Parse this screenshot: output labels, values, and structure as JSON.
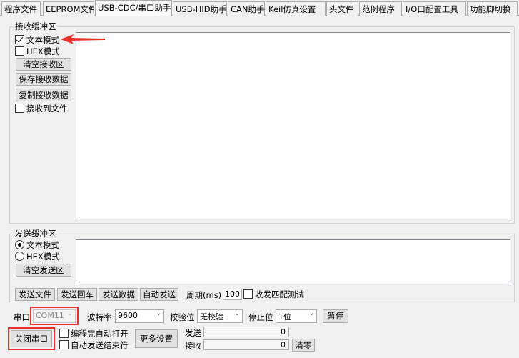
{
  "tabs": [
    {
      "label": "程序文件"
    },
    {
      "label": "EEPROM文件"
    },
    {
      "label": "USB-CDC/串口助手",
      "active": true
    },
    {
      "label": "USB-HID助手"
    },
    {
      "label": "CAN助手"
    },
    {
      "label": "Keil仿真设置"
    },
    {
      "label": "头文件"
    },
    {
      "label": "范例程序"
    },
    {
      "label": "I/O口配置工具"
    },
    {
      "label": "功能脚切换"
    }
  ],
  "receive": {
    "group_label": "接收缓冲区",
    "text_mode": "文本模式",
    "text_mode_checked": true,
    "hex_mode": "HEX模式",
    "hex_mode_checked": false,
    "clear_btn": "清空接收区",
    "save_btn": "保存接收数据",
    "copy_btn": "复制接收数据",
    "to_file": "接收到文件",
    "to_file_checked": false
  },
  "send": {
    "group_label": "发送缓冲区",
    "text_mode": "文本模式",
    "hex_mode": "HEX模式",
    "selected_mode": "text",
    "clear_btn": "清空发送区",
    "send_file": "发送文件",
    "send_enter": "发送回车",
    "send_data": "发送数据",
    "auto_send": "自动发送",
    "period_label": "周期(ms)",
    "period_value": "100",
    "match_test": "收发匹配测试",
    "match_test_checked": false
  },
  "serial": {
    "port_label": "串口",
    "port_value": "COM11",
    "baud_label": "波特率",
    "baud_value": "9600",
    "parity_label": "校验位",
    "parity_value": "无校验",
    "stop_label": "停止位",
    "stop_value": "1位",
    "pause_btn": "暂停",
    "close_btn": "关闭串口",
    "auto_open": "编程完自动打开",
    "auto_open_checked": false,
    "auto_send_end": "自动发送结束符",
    "auto_send_end_checked": false,
    "more_btn": "更多设置",
    "send_label": "发送",
    "send_count": "0",
    "recv_label": "接收",
    "recv_count": "0",
    "clear_count_btn": "清零"
  },
  "annotation_color": "#e8332a"
}
